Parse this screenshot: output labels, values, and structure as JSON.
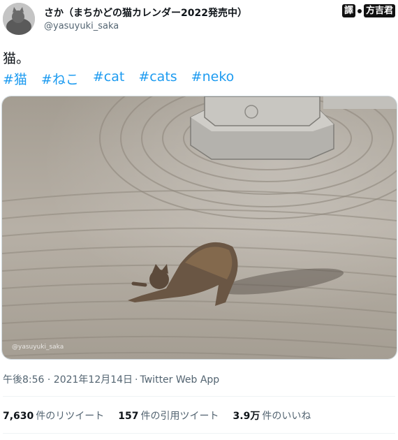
{
  "tweet": {
    "author": {
      "display_name": "さか（まちかどの猫カレンダー2022発売中）",
      "handle": "@yasuyuki_saka"
    },
    "text": "猫。",
    "hashtags": [
      "#猫",
      "#ねこ",
      "#cat",
      "#cats",
      "#neko"
    ],
    "photo": {
      "watermark": "@yasuyuki_saka"
    },
    "timestamp": "午後8:56 · 2021年12月14日",
    "source": "Twitter Web App",
    "stats": {
      "retweets": {
        "count": "7,630",
        "label": "件のリツイート"
      },
      "quotes": {
        "count": "157",
        "label": "件の引用ツイート"
      },
      "likes": {
        "count": "3.9万",
        "label": "件のいいね"
      }
    }
  },
  "overlay_badge": {
    "left": "譯",
    "right": "方吉君"
  },
  "colors": {
    "link": "#1d9bf0",
    "secondary_text": "#536471",
    "primary_text": "#0f1419"
  }
}
